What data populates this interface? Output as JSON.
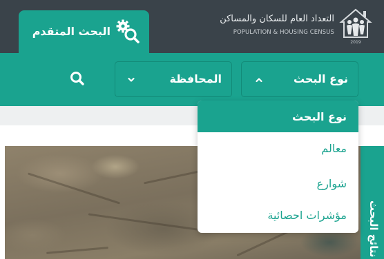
{
  "header": {
    "advanced_search_label": "البحث المتقدم",
    "brand_arabic": "التعداد العام للسكان والمساكن",
    "brand_english": "POPULATION & HOUSING CENSUS",
    "logo_year": "2019"
  },
  "filters": {
    "search_type_label": "نوع البحث",
    "governorate_label": "المحافظة"
  },
  "dropdown": {
    "header_label": "نوع البحث",
    "items": [
      "معالم",
      "شوارع",
      "مؤشرات احصائية"
    ]
  },
  "side_tab": {
    "label": "نتائج البحث"
  },
  "colors": {
    "accent": "#1aa38f",
    "header_bg": "#3a434a",
    "strip_bg": "#eef0f1"
  },
  "icons": {
    "advanced": "gears-search-icon",
    "search": "magnifier-icon",
    "chevron_up": "chevron-up-icon",
    "chevron_down": "chevron-down-icon",
    "logo": "census-logo"
  }
}
